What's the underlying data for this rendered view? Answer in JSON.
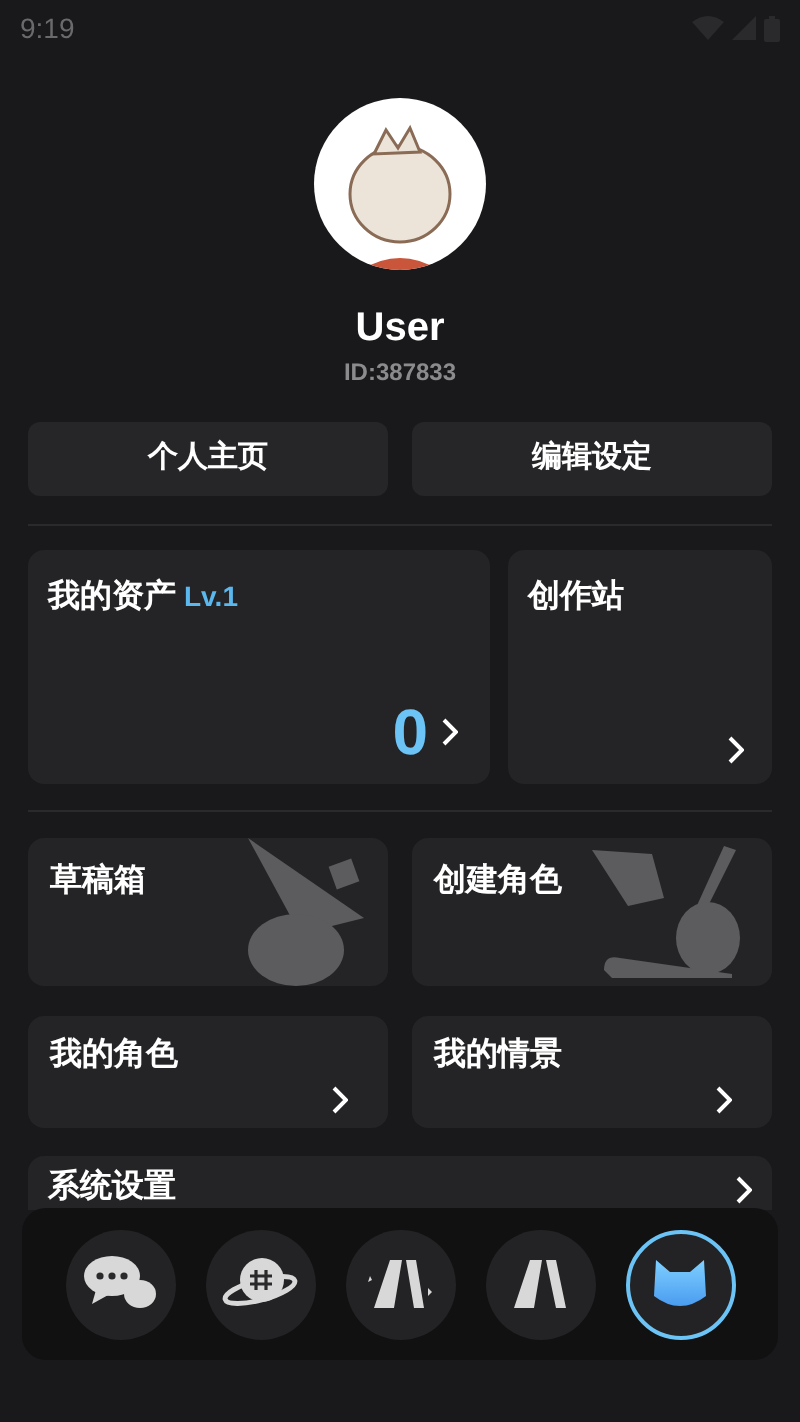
{
  "status_bar": {
    "time": "9:19"
  },
  "profile": {
    "name": "User",
    "id": "ID:387833"
  },
  "profile_buttons": [
    "个人主页",
    "编辑设定"
  ],
  "assets_card": {
    "title": "我的资产",
    "level": "Lv.1",
    "amount": "0"
  },
  "studio_card": {
    "title": "创作站"
  },
  "feature_cards": [
    {
      "title": "草稿箱",
      "kind": "drafts"
    },
    {
      "title": "创建角色",
      "kind": "create"
    }
  ],
  "list_cards": [
    {
      "title": "我的角色"
    },
    {
      "title": "我的情景"
    }
  ],
  "settings_row": {
    "title": "系统设置"
  },
  "bottom_nav": [
    {
      "kind": "chat",
      "selected": false
    },
    {
      "kind": "planet",
      "selected": false
    },
    {
      "kind": "sparkle-logo",
      "selected": false
    },
    {
      "kind": "logo",
      "selected": false
    },
    {
      "kind": "mascot",
      "selected": true
    }
  ]
}
